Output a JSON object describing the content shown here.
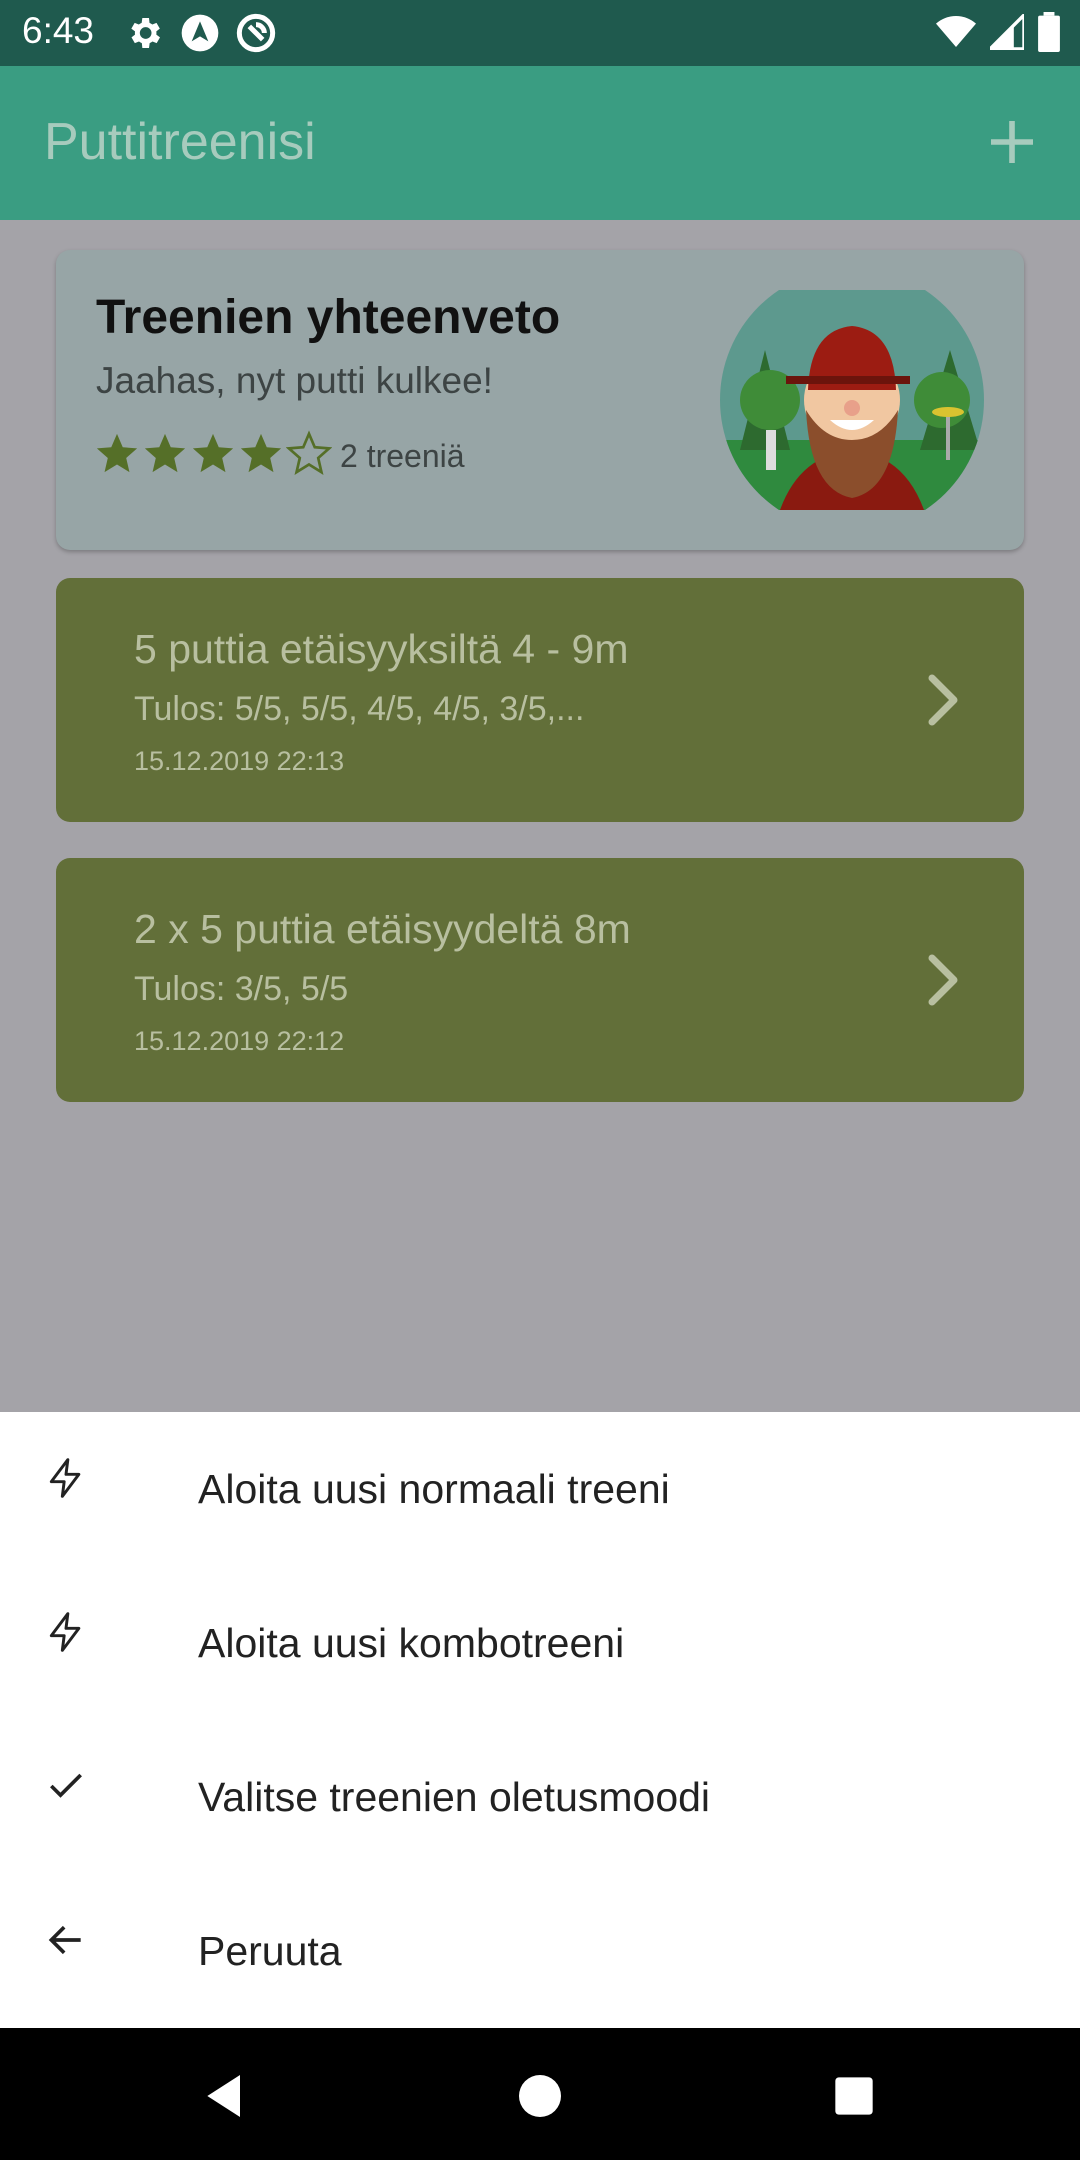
{
  "status_bar": {
    "time": "6:43",
    "icons_left": [
      "settings-icon",
      "navigation-app-icon",
      "sync-app-icon"
    ],
    "icons_right": [
      "wifi-icon",
      "cell-signal-icon",
      "battery-icon"
    ]
  },
  "app_bar": {
    "title": "Puttitreenisi",
    "action_icon": "plus-icon"
  },
  "summary": {
    "title": "Treenien yhteenveto",
    "subtitle": "Jaahas, nyt putti kulkee!",
    "rating": 4,
    "rating_max": 5,
    "count_text": "2 treeniä"
  },
  "trainings": [
    {
      "title": "5 puttia etäisyyksiltä 4 - 9m",
      "result": "Tulos: 5/5, 5/5, 4/5, 4/5, 3/5,...",
      "date": "15.12.2019 22:13"
    },
    {
      "title": "2 x 5 puttia etäisyydeltä 8m",
      "result": "Tulos: 3/5, 5/5",
      "date": "15.12.2019 22:12"
    }
  ],
  "sheet": {
    "items": [
      {
        "label": "Aloita uusi normaali treeni",
        "icon": "lightning-icon"
      },
      {
        "label": "Aloita uusi kombotreeni",
        "icon": "lightning-icon"
      },
      {
        "label": "Valitse treenien oletusmoodi",
        "icon": "check-icon"
      },
      {
        "label": "Peruuta",
        "icon": "arrow-left-icon"
      }
    ]
  },
  "nav_bar": {
    "icons": [
      "back-icon",
      "home-icon",
      "recents-icon"
    ]
  },
  "colors": {
    "status_bar": "#1f5a4e",
    "app_bar": "#3a9d82",
    "scrim_bg": "#a4a3a8",
    "card_bg": "#97a5a6",
    "training_bg": "#626f39",
    "sheet_bg": "#ffffff"
  }
}
